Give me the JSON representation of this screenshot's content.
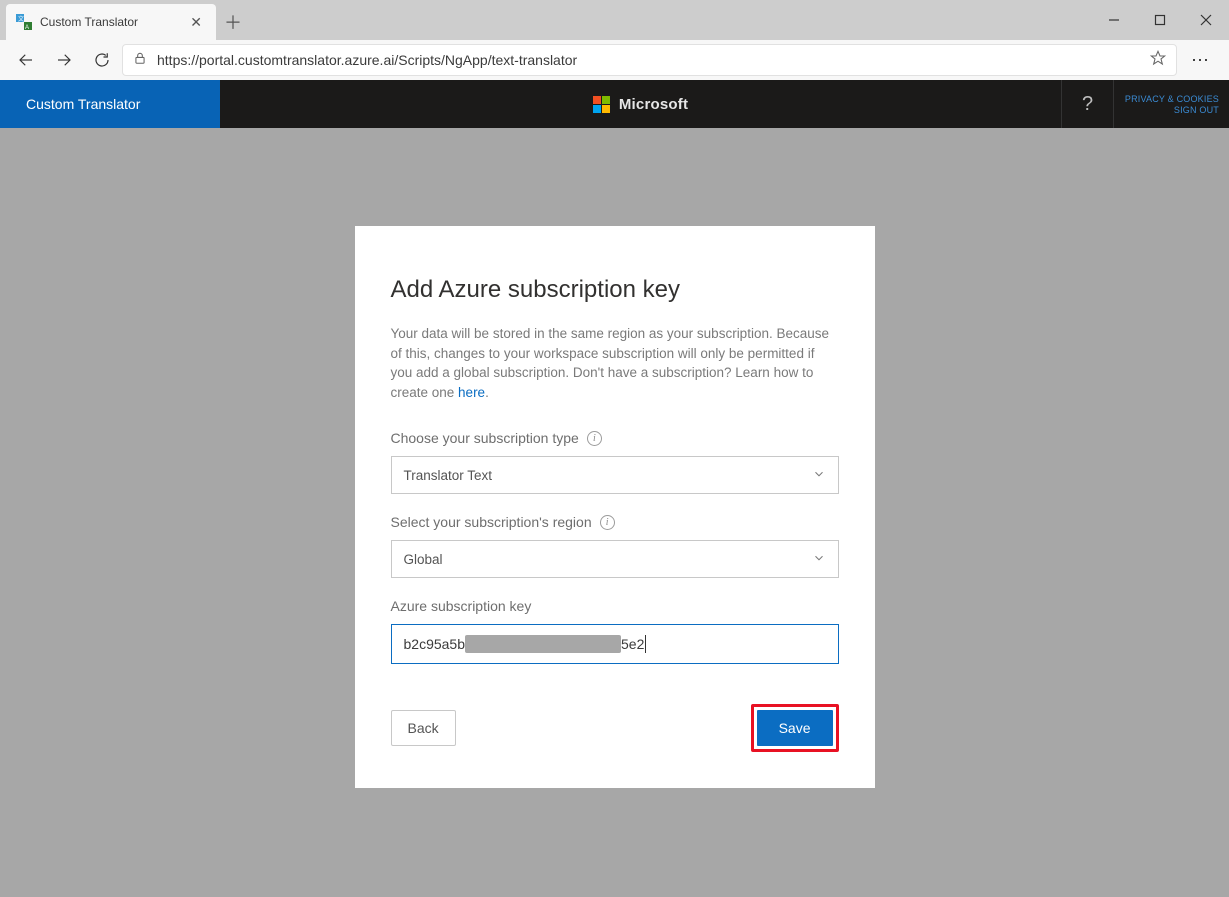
{
  "browser": {
    "tab_title": "Custom Translator",
    "url": "https://portal.customtranslator.azure.ai/Scripts/NgApp/text-translator"
  },
  "app_bar": {
    "brand": "Custom Translator",
    "logo_text": "Microsoft",
    "help_symbol": "?",
    "privacy_link": "PRIVACY & COOKIES",
    "signout_link": "SIGN OUT"
  },
  "modal": {
    "title": "Add Azure subscription key",
    "description_prefix": "Your data will be stored in the same region as your subscription. Because of this, changes to your workspace subscription will only be permitted if you add a global subscription. Don't have a subscription? Learn how to create one ",
    "description_link": "here",
    "description_suffix": ".",
    "subscription_type": {
      "label": "Choose your subscription type",
      "value": "Translator Text"
    },
    "region": {
      "label": "Select your subscription's region",
      "value": "Global"
    },
    "key": {
      "label": "Azure subscription key",
      "value_left": "b2c95a5b",
      "value_right": "5e2"
    },
    "back_label": "Back",
    "save_label": "Save"
  }
}
